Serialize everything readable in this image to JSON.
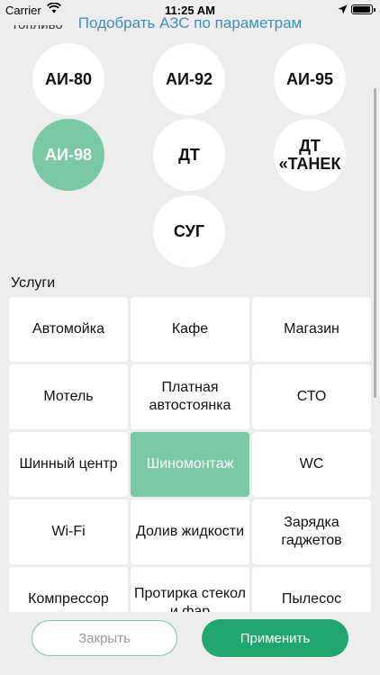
{
  "status_bar": {
    "carrier": "Carrier",
    "time": "11:25 AM"
  },
  "header": {
    "title": "Подобрать АЗС по параметрам",
    "fuel_section_label": "Топливо"
  },
  "fuel": {
    "items": [
      {
        "label": "АИ-80",
        "selected": false
      },
      {
        "label": "АИ-92",
        "selected": false
      },
      {
        "label": "АИ-95",
        "selected": false
      },
      {
        "label": "АИ-98",
        "selected": true
      },
      {
        "label": "ДТ",
        "selected": false
      },
      {
        "label": "ДТ «ТАНЕК",
        "selected": false
      },
      {
        "label": "СУГ",
        "selected": false
      }
    ]
  },
  "services": {
    "title": "Услуги",
    "items": [
      {
        "label": "Автомойка",
        "selected": false
      },
      {
        "label": "Кафе",
        "selected": false
      },
      {
        "label": "Магазин",
        "selected": false
      },
      {
        "label": "Мотель",
        "selected": false
      },
      {
        "label": "Платная автостоянка",
        "selected": false
      },
      {
        "label": "СТО",
        "selected": false
      },
      {
        "label": "Шинный центр",
        "selected": false
      },
      {
        "label": "Шиномонтаж",
        "selected": true
      },
      {
        "label": "WC",
        "selected": false
      },
      {
        "label": "Wi-Fi",
        "selected": false
      },
      {
        "label": "Долив жидкости",
        "selected": false
      },
      {
        "label": "Зарядка гаджетов",
        "selected": false
      },
      {
        "label": "Компрессор",
        "selected": false
      },
      {
        "label": "Протирка стекол и фар",
        "selected": false
      },
      {
        "label": "Пылесос",
        "selected": false
      }
    ]
  },
  "actions": {
    "close_label": "Закрыть",
    "apply_label": "Применить"
  },
  "colors": {
    "accent": "#79c9a4",
    "primary_button": "#22a670",
    "link": "#3f8fbf",
    "background": "#ededed"
  }
}
